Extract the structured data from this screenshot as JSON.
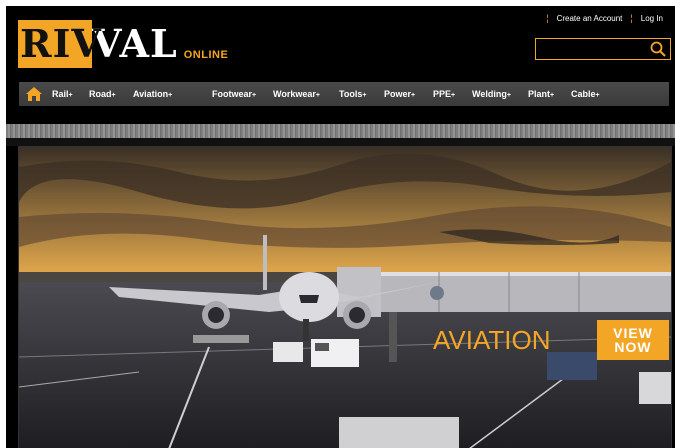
{
  "brand": {
    "logo_left": "RIV",
    "logo_right": "VAL",
    "tagline": "ONLINE",
    "accent": "#f3a626"
  },
  "account": {
    "create_label": "Create an Account",
    "login_label": "Log In"
  },
  "search": {
    "placeholder": ""
  },
  "nav": {
    "home_icon": "home-icon",
    "items": [
      {
        "label": "Rail"
      },
      {
        "label": "Road"
      },
      {
        "label": "Aviation"
      },
      {
        "label": "Footwear"
      },
      {
        "label": "Workwear"
      },
      {
        "label": "Tools"
      },
      {
        "label": "Power"
      },
      {
        "label": "PPE"
      },
      {
        "label": "Welding"
      },
      {
        "label": "Plant"
      },
      {
        "label": "Cable"
      }
    ]
  },
  "hero": {
    "title": "AVIATION",
    "cta_line1": "VIEW",
    "cta_line2": "NOW"
  }
}
